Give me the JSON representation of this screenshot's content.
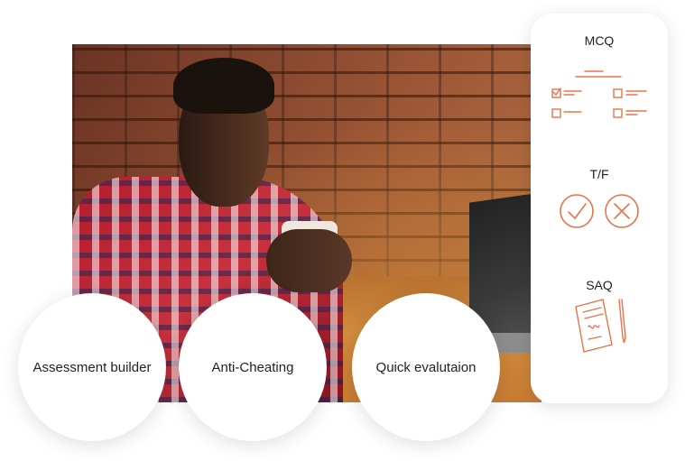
{
  "card": {
    "mcq_label": "MCQ",
    "tf_label": "T/F",
    "saq_label": "SAQ"
  },
  "features": [
    {
      "label": "Assessment builder"
    },
    {
      "label": "Anti-Cheating"
    },
    {
      "label": "Quick evalutaion"
    }
  ],
  "colors": {
    "accent": "#e8734a",
    "background": "#ffffff"
  }
}
